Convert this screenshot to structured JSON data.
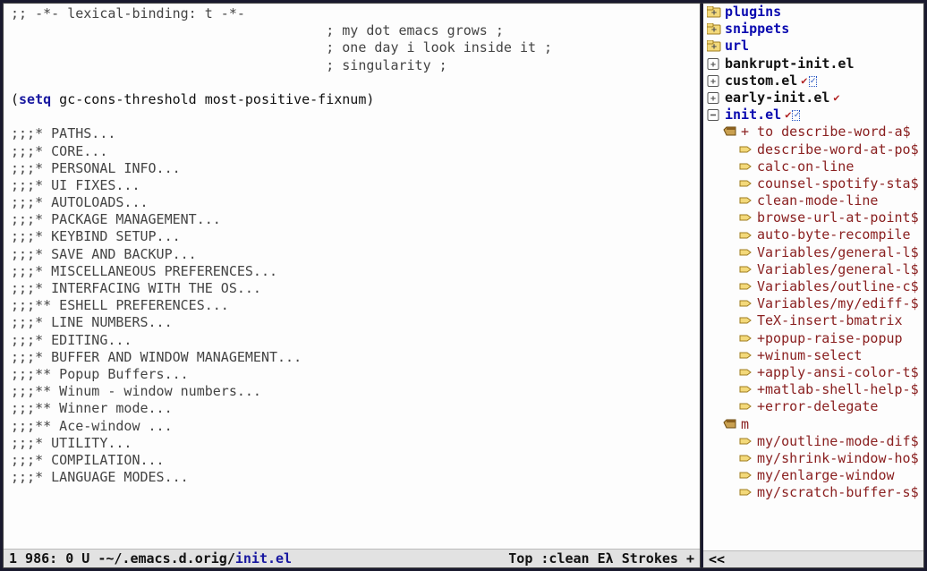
{
  "editor": {
    "header_comment": ";; -*- lexical-binding: t -*-",
    "haiku": [
      "; my dot emacs grows ;",
      "; one day i look inside it ;",
      "; singularity ;"
    ],
    "setq_open": "(",
    "setq_kw": "setq",
    "setq_rest": " gc-cons-threshold most-positive-fixnum)",
    "sections": [
      ";;;* PATHS...",
      ";;;* CORE...",
      ";;;* PERSONAL INFO...",
      ";;;* UI FIXES...",
      ";;;* AUTOLOADS...",
      ";;;* PACKAGE MANAGEMENT...",
      ";;;* KEYBIND SETUP...",
      ";;;* SAVE AND BACKUP...",
      ";;;* MISCELLANEOUS PREFERENCES...",
      ";;;* INTERFACING WITH THE OS...",
      ";;;** ESHELL PREFERENCES...",
      ";;;* LINE NUMBERS...",
      ";;;* EDITING...",
      ";;;* BUFFER AND WINDOW MANAGEMENT...",
      ";;;** Popup Buffers...",
      ";;;** Winum - window numbers...",
      ";;;** Winner mode...",
      ";;;** Ace-window ...",
      ";;;* UTILITY...",
      ";;;* COMPILATION...",
      ";;;* LANGUAGE MODES..."
    ]
  },
  "modeline": {
    "left": "1 986: 0 U -~/.emacs.d.orig/",
    "filename": "init.el",
    "right": "Top :clean Eλ Strokes +"
  },
  "sidebar": {
    "folders": [
      {
        "icon": "folder-plus",
        "label": "plugins",
        "cls": "fname-blue"
      },
      {
        "icon": "folder-plus",
        "label": "snippets",
        "cls": "fname-blue"
      },
      {
        "icon": "folder-plus",
        "label": "url",
        "cls": "fname-blue"
      },
      {
        "icon": "file-plus",
        "label": "bankrupt-init.el",
        "cls": "fname-plain"
      },
      {
        "icon": "file-plus",
        "label": "custom.el",
        "cls": "fname-plain",
        "vc": true,
        "dotted": true
      },
      {
        "icon": "file-plus",
        "label": "early-init.el",
        "cls": "fname-plain",
        "vc": true
      },
      {
        "icon": "file-minus",
        "label": "init.el",
        "cls": "current-blue",
        "vc": true,
        "dotted": true
      }
    ],
    "group1_header": {
      "icon": "bucket",
      "label": "+ to describe-word-a$",
      "indent": "indent1",
      "cls": "fname-red"
    },
    "group1": [
      "describe-word-at-po$",
      "calc-on-line",
      "counsel-spotify-sta$",
      "clean-mode-line",
      "browse-url-at-point$",
      "auto-byte-recompile",
      "Variables/general-l$",
      "Variables/general-l$",
      "Variables/outline-c$",
      "Variables/my/ediff-$",
      "TeX-insert-bmatrix",
      "+popup-raise-popup",
      "+winum-select",
      "+apply-ansi-color-t$",
      "+matlab-shell-help-$",
      "+error-delegate"
    ],
    "group2_header": {
      "icon": "bucket",
      "label": "m",
      "indent": "indent1",
      "cls": "fname-red"
    },
    "group2": [
      "my/outline-mode-dif$",
      "my/shrink-window-ho$",
      "my/enlarge-window",
      "my/scratch-buffer-s$"
    ],
    "bottom": "<<"
  }
}
